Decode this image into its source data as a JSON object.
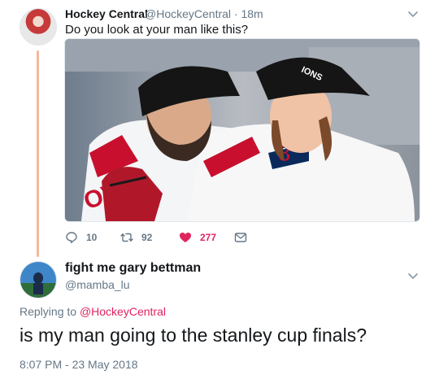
{
  "tweet": {
    "author_name": "Hockey Central",
    "author_handle": "@HockeyCentral",
    "time": "18m",
    "text": "Do you look at your man like this?",
    "actions": {
      "reply_count": "10",
      "retweet_count": "92",
      "like_count": "277"
    }
  },
  "reply": {
    "author_name": "fight me gary bettman",
    "author_handle": "@mamba_lu",
    "replying_label": "Replying to",
    "replying_to": "@HockeyCentral",
    "text": "is my man going to the stanley cup finals?",
    "timestamp": "8:07 PM - 23 May 2018"
  },
  "colors": {
    "like_red": "#e0245e",
    "thread_line": "#f5b89a",
    "secondary_text": "#657786"
  },
  "icons": [
    "reply-icon",
    "retweet-icon",
    "heart-icon",
    "dm-icon",
    "chevron-down-icon"
  ]
}
